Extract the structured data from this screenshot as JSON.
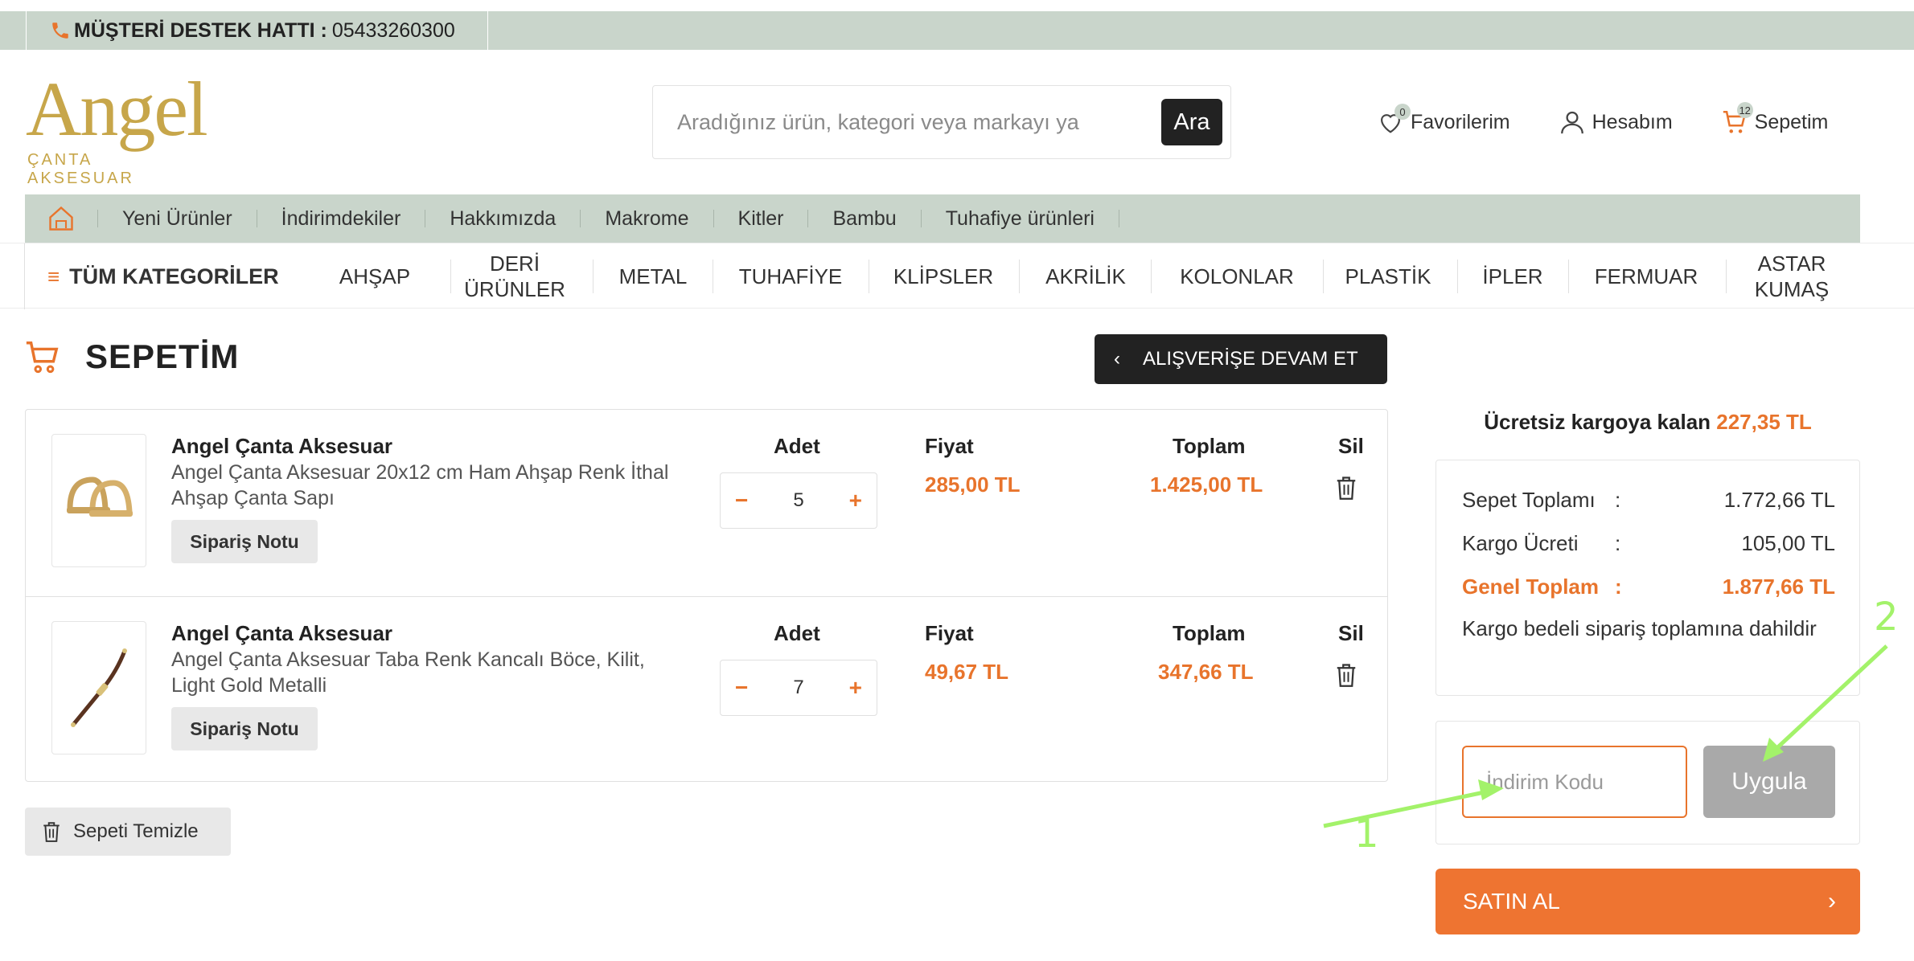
{
  "support": {
    "label": "MÜŞTERİ DESTEK HATTI :",
    "phone": "05433260300"
  },
  "logo": {
    "brand": "Angel",
    "sub": "ÇANTA AKSESUAR"
  },
  "search": {
    "placeholder": "Aradığınız ürün, kategori veya markayı ya",
    "button": "Ara"
  },
  "header": {
    "favorites": {
      "label": "Favorilerim",
      "count": "0"
    },
    "account": {
      "label": "Hesabım"
    },
    "cart": {
      "label": "Sepetim",
      "count": "12"
    }
  },
  "nav": [
    "Yeni Ürünler",
    "İndirimdekiler",
    "Hakkımızda",
    "Makrome",
    "Kitler",
    "Bambu",
    "Tuhafiye ürünleri"
  ],
  "categories": {
    "all": "TÜM KATEGORİLER",
    "items": [
      "AHŞAP",
      "DERİ ÜRÜNLER",
      "METAL",
      "TUHAFİYE",
      "KLİPSLER",
      "AKRİLİK",
      "KOLONLAR",
      "PLASTİK",
      "İPLER",
      "FERMUAR",
      "ASTAR KUMAŞ"
    ]
  },
  "page": {
    "title": "SEPETİM",
    "continue": "ALIŞVERİŞE DEVAM ET"
  },
  "columns": {
    "qty": "Adet",
    "price": "Fiyat",
    "total": "Toplam",
    "remove": "Sil"
  },
  "items": [
    {
      "brand": "Angel Çanta Aksesuar",
      "name": "Angel Çanta Aksesuar 20x12 cm Ham Ahşap Renk İthal Ahşap Çanta Sapı",
      "note": "Sipariş Notu",
      "qty": "5",
      "price": "285,00 TL",
      "total": "1.425,00 TL"
    },
    {
      "brand": "Angel Çanta Aksesuar",
      "name": "Angel Çanta Aksesuar Taba Renk Kancalı Böce, Kilit, Light Gold Metalli",
      "note": "Sipariş Notu",
      "qty": "7",
      "price": "49,67 TL",
      "total": "347,66 TL"
    }
  ],
  "clear_cart": "Sepeti Temizle",
  "free_shipping": {
    "label": "Ücretsiz kargoya kalan",
    "amount": "227,35 TL"
  },
  "summary": {
    "subtotal_label": "Sepet Toplamı",
    "subtotal": "1.772,66 TL",
    "shipping_label": "Kargo Ücreti",
    "shipping": "105,00 TL",
    "total_label": "Genel Toplam",
    "total": "1.877,66 TL",
    "colon": ":",
    "note": "Kargo bedeli sipariş toplamına dahildir"
  },
  "coupon": {
    "placeholder": "İndirim Kodu",
    "apply": "Uygula"
  },
  "buy": "SATIN AL",
  "annotations": {
    "one": "1",
    "two": "2"
  },
  "colors": {
    "accent": "#ee7431",
    "navbar": "#c9d5cb",
    "gold": "#c7a64a",
    "annotation": "#a3f26a"
  }
}
